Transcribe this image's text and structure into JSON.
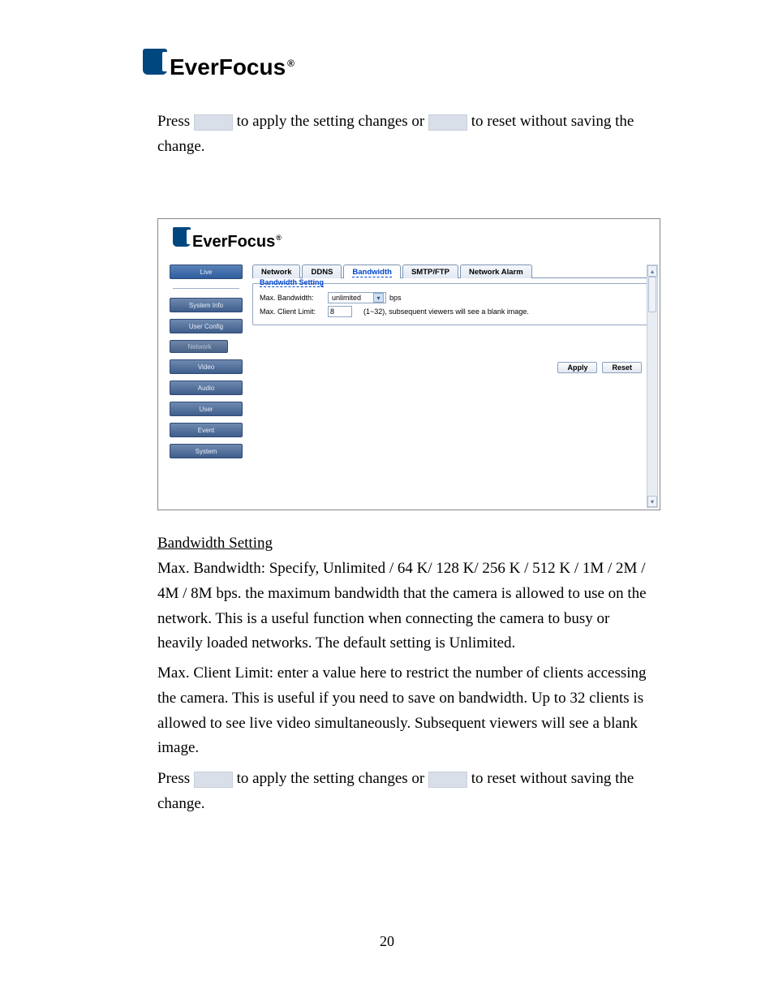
{
  "brand": "EverFocus",
  "reg": "®",
  "page_number": "20",
  "text": {
    "press1a": "Press ",
    "press1b": " to apply the setting changes or ",
    "press1c": " to reset without saving the change.",
    "heading": "Bandwidth Setting",
    "p_bw": "Max. Bandwidth: Specify, Unlimited / 64 K/ 128 K/ 256 K / 512 K / 1M / 2M / 4M / 8M bps. the maximum bandwidth that the camera is allowed to use on the network. This is a useful function when connecting the camera to busy or heavily loaded networks. The default setting is Unlimited.",
    "p_cl": "Max. Client Limit: enter a value here to restrict the number of clients accessing the camera. This is useful if you need to save on bandwidth. Up to 32 clients is allowed to see live video simultaneously. Subsequent viewers will see a blank image.",
    "press2a": "Press ",
    "press2b": " to apply the setting changes or ",
    "press2c": " to reset without saving the change."
  },
  "screenshot": {
    "sidebar": {
      "live": "Live",
      "items": [
        "System Info",
        "User Config",
        "Network",
        "Video",
        "Audio",
        "User",
        "Event",
        "System"
      ],
      "selected_index": 2
    },
    "tabs": [
      "Network",
      "DDNS",
      "Bandwidth",
      "SMTP/FTP",
      "Network Alarm"
    ],
    "active_tab_index": 2,
    "fieldset_title": "Bandwidth Setting",
    "fields": {
      "max_bw_label": "Max. Bandwidth:",
      "max_bw_value": "unlimited",
      "bps": "bps",
      "max_client_label": "Max. Client Limit:",
      "max_client_value": "8",
      "max_client_hint": "(1~32), subsequent viewers will see a blank image."
    },
    "buttons": {
      "apply": "Apply",
      "reset": "Reset"
    }
  }
}
